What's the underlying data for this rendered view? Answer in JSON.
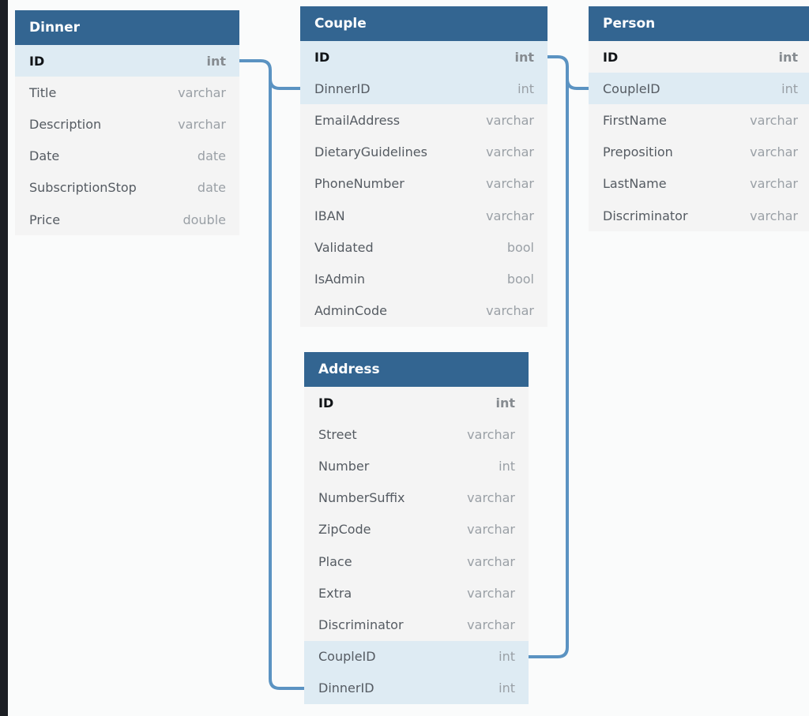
{
  "tables": {
    "dinner": {
      "title": "Dinner",
      "rows": [
        {
          "name": "ID",
          "type": "int"
        },
        {
          "name": "Title",
          "type": "varchar"
        },
        {
          "name": "Description",
          "type": "varchar"
        },
        {
          "name": "Date",
          "type": "date"
        },
        {
          "name": "SubscriptionStop",
          "type": "date"
        },
        {
          "name": "Price",
          "type": "double"
        }
      ]
    },
    "couple": {
      "title": "Couple",
      "rows": [
        {
          "name": "ID",
          "type": "int"
        },
        {
          "name": "DinnerID",
          "type": "int"
        },
        {
          "name": "EmailAddress",
          "type": "varchar"
        },
        {
          "name": "DietaryGuidelines",
          "type": "varchar"
        },
        {
          "name": "PhoneNumber",
          "type": "varchar"
        },
        {
          "name": "IBAN",
          "type": "varchar"
        },
        {
          "name": "Validated",
          "type": "bool"
        },
        {
          "name": "IsAdmin",
          "type": "bool"
        },
        {
          "name": "AdminCode",
          "type": "varchar"
        }
      ]
    },
    "person": {
      "title": "Person",
      "rows": [
        {
          "name": "ID",
          "type": "int"
        },
        {
          "name": "CoupleID",
          "type": "int"
        },
        {
          "name": "FirstName",
          "type": "varchar"
        },
        {
          "name": "Preposition",
          "type": "varchar"
        },
        {
          "name": "LastName",
          "type": "varchar"
        },
        {
          "name": "Discriminator",
          "type": "varchar"
        }
      ]
    },
    "address": {
      "title": "Address",
      "rows": [
        {
          "name": "ID",
          "type": "int"
        },
        {
          "name": "Street",
          "type": "varchar"
        },
        {
          "name": "Number",
          "type": "int"
        },
        {
          "name": "NumberSuffix",
          "type": "varchar"
        },
        {
          "name": "ZipCode",
          "type": "varchar"
        },
        {
          "name": "Place",
          "type": "varchar"
        },
        {
          "name": "Extra",
          "type": "varchar"
        },
        {
          "name": "Discriminator",
          "type": "varchar"
        },
        {
          "name": "CoupleID",
          "type": "int"
        },
        {
          "name": "DinnerID",
          "type": "int"
        }
      ]
    }
  },
  "colors": {
    "header": "#336591",
    "highlight": "#deebf3",
    "connector": "#5b93c2"
  }
}
